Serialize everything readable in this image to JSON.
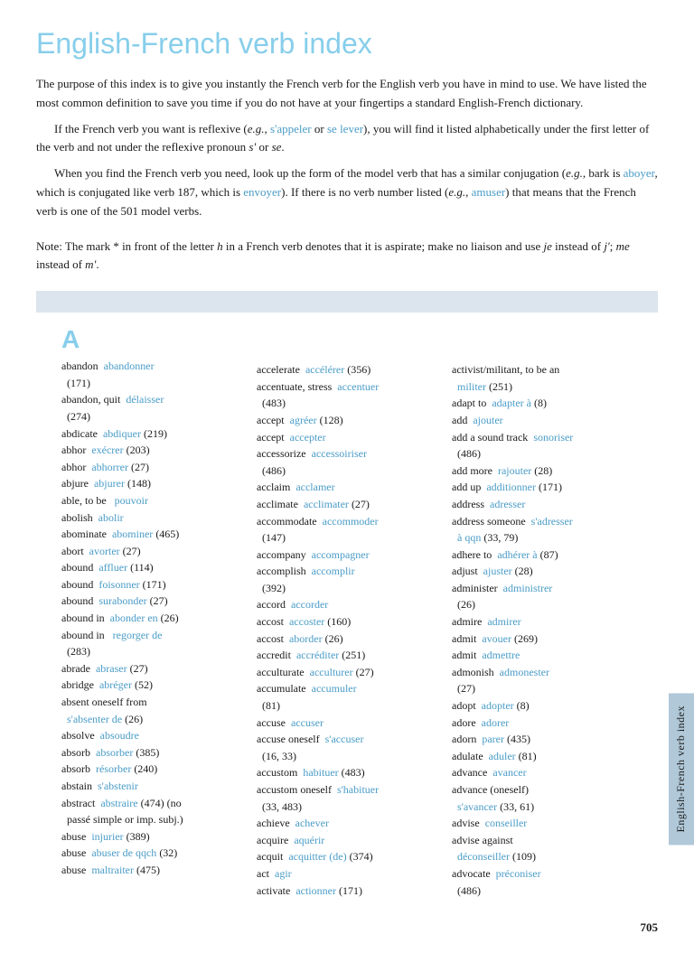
{
  "page": {
    "title": "English-French verb index",
    "intro": {
      "para1": "The purpose of this index is to give you instantly the French verb for the English verb you have in mind to use. We have listed the most common definition to save you time if you do not have at your fingertips a standard English-French dictionary.",
      "para2_start": "If the French verb you want is reflexive (",
      "para2_eg": "e.g.,",
      "para2_link1": "s'appeler",
      "para2_mid": " or ",
      "para2_link2": "se lever",
      "para2_end": "), you will find it listed alphabetically under the first letter of the verb and not under the reflexive pronoun ",
      "para2_s": "s'",
      "para2_or": " or ",
      "para2_se": "se",
      "para2_dot": ".",
      "para3_start": "When you find the French verb you need, look up the form of the model verb that has a similar conjugation (",
      "para3_eg": "e.g.,",
      "para3_mid1": " bark is ",
      "para3_link1": "aboyer",
      "para3_mid2": ", which is conjugated like verb 187, which is ",
      "para3_link2": "envoyer",
      "para3_end": "). If there is no verb number listed (",
      "para3_eg2": "e.g.,",
      "para3_link3": " amuser",
      "para3_end2": ") that means that the French verb is one of the 501 model verbs.",
      "note": "Note: The mark * in front of the letter h in a French verb denotes that it is aspirate; make no liaison and use je instead of j'; me instead of m'."
    },
    "letter": "A",
    "columns": {
      "col1": [
        {
          "en": "abandon",
          "fr": "abandonner",
          "num": "(171)"
        },
        {
          "en": "abandon, quit",
          "fr": "délaisser",
          "num": "(274)"
        },
        {
          "en": "abdicate",
          "fr": "abdiquer",
          "num": "(219)"
        },
        {
          "en": "abhor",
          "fr": "exécrer",
          "num": "(203)"
        },
        {
          "en": "abhor",
          "fr": "abhorrer",
          "num": "(27)"
        },
        {
          "en": "abjure",
          "fr": "abjurer",
          "num": "(148)"
        },
        {
          "en": "able, to be",
          "fr": "pouvoir",
          "num": ""
        },
        {
          "en": "abolish",
          "fr": "abolir",
          "num": ""
        },
        {
          "en": "abominate",
          "fr": "abominer",
          "num": "(465)"
        },
        {
          "en": "abort",
          "fr": "avorter",
          "num": "(27)"
        },
        {
          "en": "abound",
          "fr": "affluer",
          "num": "(114)"
        },
        {
          "en": "abound",
          "fr": "foisonner",
          "num": "(171)"
        },
        {
          "en": "abound",
          "fr": "surabonder",
          "num": "(27)"
        },
        {
          "en": "abound in",
          "fr": "abonder en",
          "num": "(26)"
        },
        {
          "en": "abound in",
          "fr": "regorger de",
          "num": "(283)"
        },
        {
          "en": "abrade",
          "fr": "abraser",
          "num": "(27)"
        },
        {
          "en": "abridge",
          "fr": "abréger",
          "num": "(52)"
        },
        {
          "en": "absent oneself from",
          "fr": "s'absenter de",
          "num": "(26)"
        },
        {
          "en": "absolve",
          "fr": "absoudre",
          "num": ""
        },
        {
          "en": "absorb",
          "fr": "absorber",
          "num": "(385)"
        },
        {
          "en": "absorb",
          "fr": "résorber",
          "num": "(240)"
        },
        {
          "en": "abstain",
          "fr": "s'abstenir",
          "num": ""
        },
        {
          "en": "abstract",
          "fr": "abstraire",
          "num": "(474) (no passé simple or imp. subj.)"
        },
        {
          "en": "abuse",
          "fr": "injurier",
          "num": "(389)"
        },
        {
          "en": "abuse",
          "fr": "abuser de qqch",
          "num": "(32)"
        },
        {
          "en": "abuse",
          "fr": "maltraiter",
          "num": "(475)"
        }
      ],
      "col2": [
        {
          "en": "accelerate",
          "fr": "accélérer",
          "num": "(356)"
        },
        {
          "en": "accentuate, stress",
          "fr": "accentuer",
          "num": "(483)"
        },
        {
          "en": "accept",
          "fr": "agréer",
          "num": "(128)"
        },
        {
          "en": "accept",
          "fr": "accepter",
          "num": ""
        },
        {
          "en": "accessorize",
          "fr": "accessoiriser",
          "num": "(486)"
        },
        {
          "en": "acclaim",
          "fr": "acclamer",
          "num": ""
        },
        {
          "en": "acclimate",
          "fr": "acclimater",
          "num": "(27)"
        },
        {
          "en": "accommodate",
          "fr": "accommoder",
          "num": "(147)"
        },
        {
          "en": "accompany",
          "fr": "accompagner",
          "num": ""
        },
        {
          "en": "accomplish",
          "fr": "accomplir",
          "num": "(392)"
        },
        {
          "en": "accord",
          "fr": "accorder",
          "num": ""
        },
        {
          "en": "accost",
          "fr": "accoster",
          "num": "(160)"
        },
        {
          "en": "accost",
          "fr": "aborder",
          "num": "(26)"
        },
        {
          "en": "accredit",
          "fr": "accréditer",
          "num": "(251)"
        },
        {
          "en": "acculturate",
          "fr": "acculturer",
          "num": "(27)"
        },
        {
          "en": "accumulate",
          "fr": "accumuler",
          "num": "(81)"
        },
        {
          "en": "accuse",
          "fr": "accuser",
          "num": ""
        },
        {
          "en": "accuse oneself",
          "fr": "s'accuser",
          "num": "(16, 33)"
        },
        {
          "en": "accustom",
          "fr": "habituer",
          "num": "(483)"
        },
        {
          "en": "accustom oneself",
          "fr": "s'habituer",
          "num": "(33, 483)"
        },
        {
          "en": "achieve",
          "fr": "achever",
          "num": ""
        },
        {
          "en": "acquire",
          "fr": "aquérir",
          "num": ""
        },
        {
          "en": "acquit",
          "fr": "acquitter (de)",
          "num": "(374)"
        },
        {
          "en": "act",
          "fr": "agir",
          "num": ""
        },
        {
          "en": "activate",
          "fr": "actionner",
          "num": "(171)"
        }
      ],
      "col3": [
        {
          "en": "activist/militant, to be an",
          "fr": "militer",
          "num": "(251)"
        },
        {
          "en": "adapt to",
          "fr": "adapter à",
          "num": "(8)"
        },
        {
          "en": "add",
          "fr": "ajouter",
          "num": ""
        },
        {
          "en": "add a sound track",
          "fr": "sonoriser",
          "num": "(486)"
        },
        {
          "en": "add more",
          "fr": "rajouter",
          "num": "(28)"
        },
        {
          "en": "add up",
          "fr": "additionner",
          "num": "(171)"
        },
        {
          "en": "address",
          "fr": "adresser",
          "num": ""
        },
        {
          "en": "address someone",
          "fr": "s'adresser à qqn",
          "num": "(33, 79)"
        },
        {
          "en": "adhere to",
          "fr": "adhérer à",
          "num": "(87)"
        },
        {
          "en": "adjust",
          "fr": "ajuster",
          "num": "(28)"
        },
        {
          "en": "administer",
          "fr": "administrer",
          "num": "(26)"
        },
        {
          "en": "admire",
          "fr": "admirer",
          "num": ""
        },
        {
          "en": "admit",
          "fr": "avouer",
          "num": "(269)"
        },
        {
          "en": "admit",
          "fr": "admettre",
          "num": ""
        },
        {
          "en": "admonish",
          "fr": "admonester",
          "num": "(27)"
        },
        {
          "en": "adopt",
          "fr": "adopter",
          "num": "(8)"
        },
        {
          "en": "adore",
          "fr": "adorer",
          "num": ""
        },
        {
          "en": "adorn",
          "fr": "parer",
          "num": "(435)"
        },
        {
          "en": "adulate",
          "fr": "aduler",
          "num": "(81)"
        },
        {
          "en": "advance",
          "fr": "avancer",
          "num": ""
        },
        {
          "en": "advance (oneself)",
          "fr": "s'avancer",
          "num": "(33, 61)"
        },
        {
          "en": "advise",
          "fr": "conseiller",
          "num": ""
        },
        {
          "en": "advise against",
          "fr": "déconseiller",
          "num": "(109)"
        },
        {
          "en": "advocate",
          "fr": "préconiser",
          "num": "(486)"
        }
      ]
    },
    "sidetab": "English-French verb index",
    "page_number": "705"
  }
}
